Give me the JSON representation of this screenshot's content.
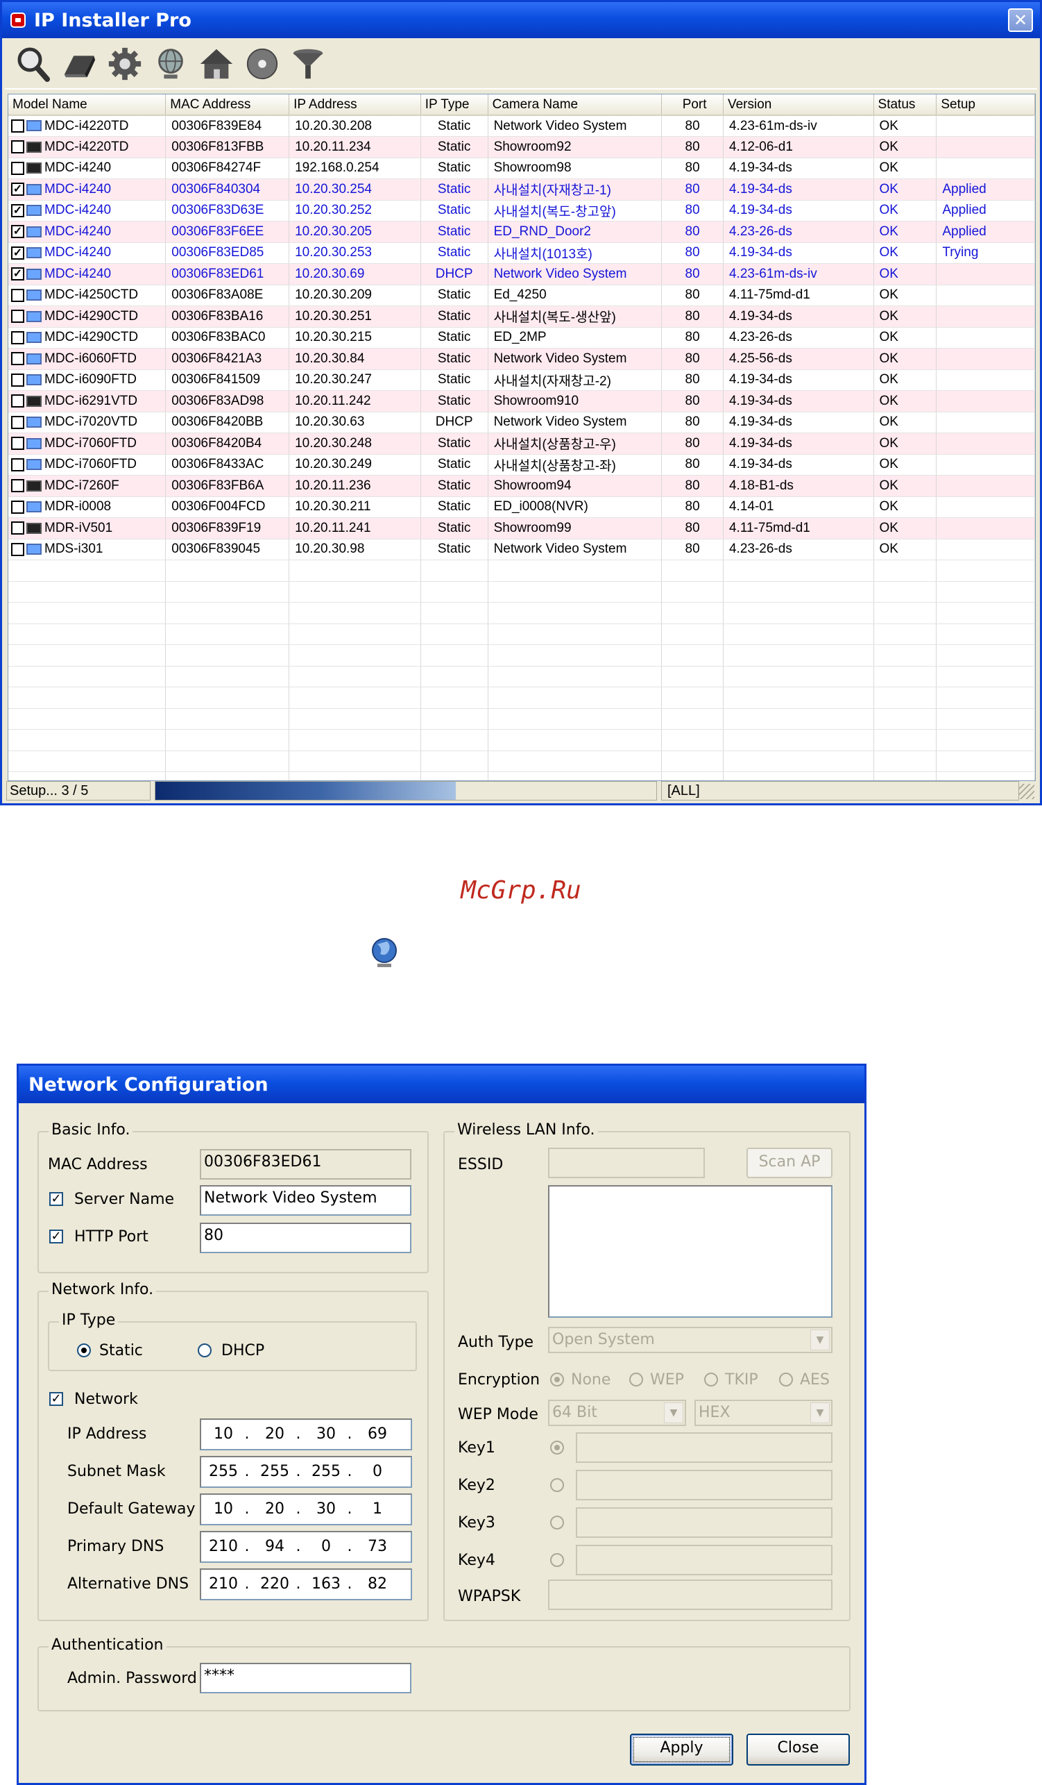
{
  "main_window": {
    "title": "IP Installer Pro",
    "close_glyph": "✕",
    "toolbar": [
      "search-icon",
      "eraser-icon",
      "gear-icon",
      "globe-icon",
      "home-icon",
      "disc-icon",
      "filter-icon"
    ],
    "columns": [
      "Model Name",
      "MAC Address",
      "IP Address",
      "IP Type",
      "Camera Name",
      "Port",
      "Version",
      "Status",
      "Setup"
    ],
    "rows": [
      {
        "checked": false,
        "icon": "blue",
        "model": "MDC-i4220TD",
        "mac": "00306F839E84",
        "ip": "10.20.30.208",
        "type": "Static",
        "camera": "Network Video System",
        "port": "80",
        "version": "4.23-61m-ds-iv",
        "status": "OK",
        "setup": "",
        "style": "white"
      },
      {
        "checked": false,
        "icon": "dark",
        "model": "MDC-i4220TD",
        "mac": "00306F813FBB",
        "ip": "10.20.11.234",
        "type": "Static",
        "camera": "Showroom92",
        "port": "80",
        "version": "4.12-06-d1",
        "status": "OK",
        "setup": "",
        "style": "pink"
      },
      {
        "checked": false,
        "icon": "dark",
        "model": "MDC-i4240",
        "mac": "00306F84274F",
        "ip": "192.168.0.254",
        "type": "Static",
        "camera": "Showroom98",
        "port": "80",
        "version": "4.19-34-ds",
        "status": "OK",
        "setup": "",
        "style": "white"
      },
      {
        "checked": true,
        "icon": "blue",
        "model": "MDC-i4240",
        "mac": "00306F840304",
        "ip": "10.20.30.254",
        "type": "Static",
        "camera": "사내설치(자재창고-1)",
        "port": "80",
        "version": "4.19-34-ds",
        "status": "OK",
        "setup": "Applied",
        "style": "pink-blue"
      },
      {
        "checked": true,
        "icon": "blue",
        "model": "MDC-i4240",
        "mac": "00306F83D63E",
        "ip": "10.20.30.252",
        "type": "Static",
        "camera": "사내설치(복도-창고앞)",
        "port": "80",
        "version": "4.19-34-ds",
        "status": "OK",
        "setup": "Applied",
        "style": "white-blue"
      },
      {
        "checked": true,
        "icon": "blue",
        "model": "MDC-i4240",
        "mac": "00306F83F6EE",
        "ip": "10.20.30.205",
        "type": "Static",
        "camera": "ED_RND_Door2",
        "port": "80",
        "version": "4.23-26-ds",
        "status": "OK",
        "setup": "Applied",
        "style": "pink-blue"
      },
      {
        "checked": true,
        "icon": "blue",
        "model": "MDC-i4240",
        "mac": "00306F83ED85",
        "ip": "10.20.30.253",
        "type": "Static",
        "camera": "사내설치(1013호)",
        "port": "80",
        "version": "4.19-34-ds",
        "status": "OK",
        "setup": "Trying",
        "style": "white-blue"
      },
      {
        "checked": true,
        "icon": "blue",
        "model": "MDC-i4240",
        "mac": "00306F83ED61",
        "ip": "10.20.30.69",
        "type": "DHCP",
        "camera": "Network Video System",
        "port": "80",
        "version": "4.23-61m-ds-iv",
        "status": "OK",
        "setup": "",
        "style": "pink-blue"
      },
      {
        "checked": false,
        "icon": "blue",
        "model": "MDC-i4250CTD",
        "mac": "00306F83A08E",
        "ip": "10.20.30.209",
        "type": "Static",
        "camera": "Ed_4250",
        "port": "80",
        "version": "4.11-75md-d1",
        "status": "OK",
        "setup": "",
        "style": "white"
      },
      {
        "checked": false,
        "icon": "blue",
        "model": "MDC-i4290CTD",
        "mac": "00306F83BA16",
        "ip": "10.20.30.251",
        "type": "Static",
        "camera": "사내설치(복도-생산앞)",
        "port": "80",
        "version": "4.19-34-ds",
        "status": "OK",
        "setup": "",
        "style": "pink"
      },
      {
        "checked": false,
        "icon": "blue",
        "model": "MDC-i4290CTD",
        "mac": "00306F83BAC0",
        "ip": "10.20.30.215",
        "type": "Static",
        "camera": "ED_2MP",
        "port": "80",
        "version": "4.23-26-ds",
        "status": "OK",
        "setup": "",
        "style": "white"
      },
      {
        "checked": false,
        "icon": "blue",
        "model": "MDC-i6060FTD",
        "mac": "00306F8421A3",
        "ip": "10.20.30.84",
        "type": "Static",
        "camera": "Network Video System",
        "port": "80",
        "version": "4.25-56-ds",
        "status": "OK",
        "setup": "",
        "style": "pink"
      },
      {
        "checked": false,
        "icon": "blue",
        "model": "MDC-i6090FTD",
        "mac": "00306F841509",
        "ip": "10.20.30.247",
        "type": "Static",
        "camera": "사내설치(자재창고-2)",
        "port": "80",
        "version": "4.19-34-ds",
        "status": "OK",
        "setup": "",
        "style": "white"
      },
      {
        "checked": false,
        "icon": "dark",
        "model": "MDC-i6291VTD",
        "mac": "00306F83AD98",
        "ip": "10.20.11.242",
        "type": "Static",
        "camera": "Showroom910",
        "port": "80",
        "version": "4.19-34-ds",
        "status": "OK",
        "setup": "",
        "style": "pink"
      },
      {
        "checked": false,
        "icon": "blue",
        "model": "MDC-i7020VTD",
        "mac": "00306F8420BB",
        "ip": "10.20.30.63",
        "type": "DHCP",
        "camera": "Network Video System",
        "port": "80",
        "version": "4.19-34-ds",
        "status": "OK",
        "setup": "",
        "style": "white"
      },
      {
        "checked": false,
        "icon": "blue",
        "model": "MDC-i7060FTD",
        "mac": "00306F8420B4",
        "ip": "10.20.30.248",
        "type": "Static",
        "camera": "사내설치(상품창고-우)",
        "port": "80",
        "version": "4.19-34-ds",
        "status": "OK",
        "setup": "",
        "style": "pink"
      },
      {
        "checked": false,
        "icon": "blue",
        "model": "MDC-i7060FTD",
        "mac": "00306F8433AC",
        "ip": "10.20.30.249",
        "type": "Static",
        "camera": "사내설치(상품창고-좌)",
        "port": "80",
        "version": "4.19-34-ds",
        "status": "OK",
        "setup": "",
        "style": "white"
      },
      {
        "checked": false,
        "icon": "dark",
        "model": "MDC-i7260F",
        "mac": "00306F83FB6A",
        "ip": "10.20.11.236",
        "type": "Static",
        "camera": "Showroom94",
        "port": "80",
        "version": "4.18-B1-ds",
        "status": "OK",
        "setup": "",
        "style": "pink"
      },
      {
        "checked": false,
        "icon": "blue",
        "model": "MDR-i0008",
        "mac": "00306F004FCD",
        "ip": "10.20.30.211",
        "type": "Static",
        "camera": "ED_i0008(NVR)",
        "port": "80",
        "version": "4.14-01",
        "status": "OK",
        "setup": "",
        "style": "white"
      },
      {
        "checked": false,
        "icon": "dark",
        "model": "MDR-iV501",
        "mac": "00306F839F19",
        "ip": "10.20.11.241",
        "type": "Static",
        "camera": "Showroom99",
        "port": "80",
        "version": "4.11-75md-d1",
        "status": "OK",
        "setup": "",
        "style": "pink"
      },
      {
        "checked": false,
        "icon": "blue",
        "model": "MDS-i301",
        "mac": "00306F839045",
        "ip": "10.20.30.98",
        "type": "Static",
        "camera": "Network Video System",
        "port": "80",
        "version": "4.23-26-ds",
        "status": "OK",
        "setup": "",
        "style": "white"
      }
    ],
    "empty_rows": 11,
    "status": {
      "text": "Setup... 3 / 5",
      "progress": 0.6,
      "filter": "[ALL]"
    }
  },
  "watermark": "McGrp.Ru",
  "dialog": {
    "title": "Network Configuration",
    "basic": {
      "group": "Basic Info.",
      "mac_label": "MAC Address",
      "mac_value": "00306F83ED61",
      "server_label": "Server Name",
      "server_value": "Network Video System",
      "server_checked": true,
      "http_label": "HTTP Port",
      "http_value": "80",
      "http_checked": true
    },
    "network": {
      "group": "Network Info.",
      "iptype_group": "IP Type",
      "static_label": "Static",
      "dhcp_label": "DHCP",
      "selected": "Static",
      "network_label": "Network",
      "network_checked": true,
      "fields": [
        {
          "label": "IP Address",
          "octets": [
            "10",
            "20",
            "30",
            "69"
          ]
        },
        {
          "label": "Subnet Mask",
          "octets": [
            "255",
            "255",
            "255",
            "0"
          ]
        },
        {
          "label": "Default Gateway",
          "octets": [
            "10",
            "20",
            "30",
            "1"
          ]
        },
        {
          "label": "Primary DNS",
          "octets": [
            "210",
            "94",
            "0",
            "73"
          ]
        },
        {
          "label": "Alternative DNS",
          "octets": [
            "210",
            "220",
            "163",
            "82"
          ]
        }
      ]
    },
    "wireless": {
      "group": "Wireless LAN Info.",
      "essid_label": "ESSID",
      "essid_value": "",
      "scan_button": "Scan AP",
      "auth_label": "Auth Type",
      "auth_value": "Open System",
      "enc_label": "Encryption",
      "enc_options": [
        "None",
        "WEP",
        "TKIP",
        "AES"
      ],
      "wep_label": "WEP Mode",
      "wep_bits": "64 Bit",
      "wep_format": "HEX",
      "keys": [
        "Key1",
        "Key2",
        "Key3",
        "Key4"
      ],
      "wpapsk_label": "WPAPSK"
    },
    "auth": {
      "group": "Authentication",
      "password_label": "Admin. Password",
      "password_value": "****"
    },
    "apply_button": "Apply",
    "close_button": "Close"
  }
}
